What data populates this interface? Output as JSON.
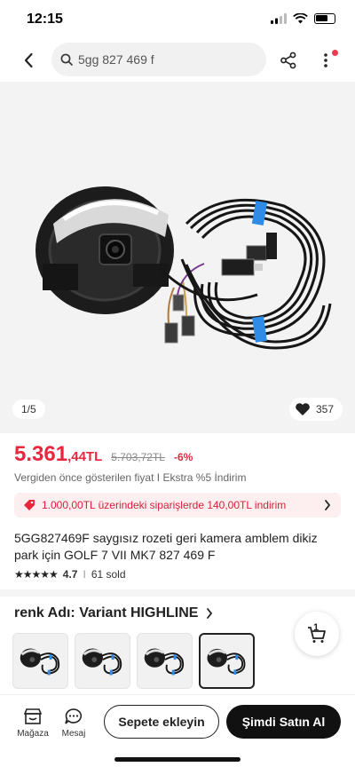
{
  "status": {
    "time": "12:15"
  },
  "search": {
    "query": "5gg 827 469 f"
  },
  "gallery": {
    "counter": "1/5",
    "favorites": "357"
  },
  "price": {
    "integer": "5.361",
    "decimal": ",44TL",
    "old": "5.703,72TL",
    "discount": "-6%",
    "note": "Vergiden önce gösterilen fiyat I Ekstra %5 İndirim"
  },
  "coupon": {
    "text": "1.000,00TL üzerindeki siparişlerde 140,00TL indirim"
  },
  "product": {
    "title": "5GG827469F saygısız rozeti geri kamera amblem dikiz park için GOLF 7 VII MK7 827 469 F",
    "rating": "4.7",
    "rating_separator": "I",
    "sold": "61 sold",
    "stars": "★★★★★"
  },
  "variant": {
    "label": "renk Adı: Variant HIGHLINE",
    "thumbnail_count": 4,
    "selected_index": 3
  },
  "cart_fab": {
    "count": "1"
  },
  "bottom_bar": {
    "store_label": "Mağaza",
    "message_label": "Mesaj",
    "add_to_cart": "Sepete ekleyin",
    "buy_now": "Şimdi Satın Al"
  },
  "colors": {
    "accent": "#e8263d",
    "coupon_bg": "#fdeef0",
    "cable_tag": "#2f8ce6"
  }
}
